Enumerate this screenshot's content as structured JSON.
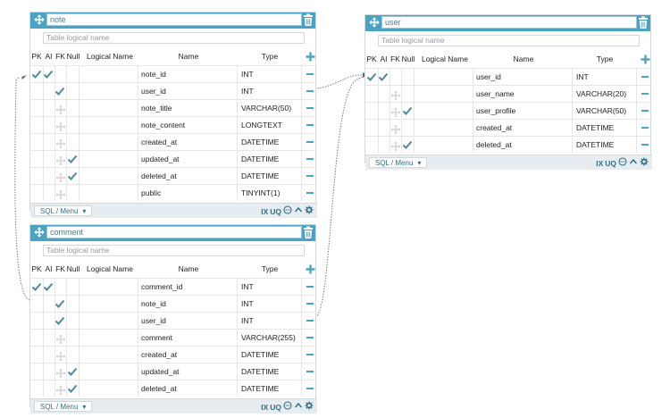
{
  "columns_header": {
    "pk": "PK",
    "ai": "AI",
    "fk": "FK",
    "null": "Null",
    "logical": "Logical Name",
    "name": "Name",
    "type": "Type"
  },
  "logical_placeholder": "Table logical name",
  "footer": {
    "sql_menu": "SQL / Menu",
    "ix": "IX",
    "uq": "UQ"
  },
  "tables": {
    "note": {
      "name": "note",
      "columns": [
        {
          "pk": true,
          "ai": true,
          "fk": false,
          "null": false,
          "name": "note_id",
          "type": "INT"
        },
        {
          "pk": false,
          "ai": false,
          "fk": true,
          "null": false,
          "name": "user_id",
          "type": "INT"
        },
        {
          "pk": false,
          "ai": false,
          "fk": false,
          "null": false,
          "name": "note_title",
          "type": "VARCHAR(50)"
        },
        {
          "pk": false,
          "ai": false,
          "fk": false,
          "null": false,
          "name": "note_content",
          "type": "LONGTEXT"
        },
        {
          "pk": false,
          "ai": false,
          "fk": false,
          "null": false,
          "name": "created_at",
          "type": "DATETIME"
        },
        {
          "pk": false,
          "ai": false,
          "fk": false,
          "null": true,
          "name": "updated_at",
          "type": "DATETIME"
        },
        {
          "pk": false,
          "ai": false,
          "fk": false,
          "null": true,
          "name": "deleted_at",
          "type": "DATETIME"
        },
        {
          "pk": false,
          "ai": false,
          "fk": false,
          "null": false,
          "name": "public",
          "type": "TINYINT(1)"
        }
      ]
    },
    "comment": {
      "name": "comment",
      "columns": [
        {
          "pk": true,
          "ai": true,
          "fk": false,
          "null": false,
          "name": "comment_id",
          "type": "INT"
        },
        {
          "pk": false,
          "ai": false,
          "fk": true,
          "null": false,
          "name": "note_id",
          "type": "INT"
        },
        {
          "pk": false,
          "ai": false,
          "fk": true,
          "null": false,
          "name": "user_id",
          "type": "INT"
        },
        {
          "pk": false,
          "ai": false,
          "fk": false,
          "null": false,
          "name": "comment",
          "type": "VARCHAR(255)"
        },
        {
          "pk": false,
          "ai": false,
          "fk": false,
          "null": false,
          "name": "created_at",
          "type": "DATETIME"
        },
        {
          "pk": false,
          "ai": false,
          "fk": false,
          "null": true,
          "name": "updated_at",
          "type": "DATETIME"
        },
        {
          "pk": false,
          "ai": false,
          "fk": false,
          "null": true,
          "name": "deleted_at",
          "type": "DATETIME"
        }
      ]
    },
    "user": {
      "name": "user",
      "columns": [
        {
          "pk": true,
          "ai": true,
          "fk": false,
          "null": false,
          "name": "user_id",
          "type": "INT"
        },
        {
          "pk": false,
          "ai": false,
          "fk": false,
          "null": false,
          "name": "user_name",
          "type": "VARCHAR(20)"
        },
        {
          "pk": false,
          "ai": false,
          "fk": false,
          "null": true,
          "name": "user_profile",
          "type": "VARCHAR(50)"
        },
        {
          "pk": false,
          "ai": false,
          "fk": false,
          "null": false,
          "name": "created_at",
          "type": "DATETIME"
        },
        {
          "pk": false,
          "ai": false,
          "fk": false,
          "null": true,
          "name": "deleted_at",
          "type": "DATETIME"
        }
      ]
    }
  },
  "colors": {
    "header": "#4aa3c4",
    "check": "#4d8a9e",
    "footer": "#e6ecef"
  }
}
